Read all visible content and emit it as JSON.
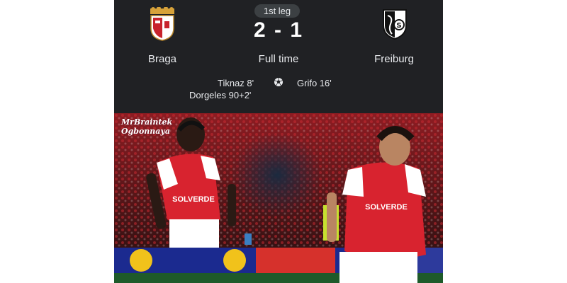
{
  "match": {
    "leg_label": "1st leg",
    "score": "2 - 1",
    "status": "Full time",
    "home": {
      "name": "Braga",
      "crest_icon": "braga-crest-icon",
      "scorers": [
        "Tiknaz 8'",
        "Dorgeles 90+2'"
      ]
    },
    "away": {
      "name": "Freiburg",
      "crest_icon": "freiburg-crest-icon",
      "scorers": [
        "Grifo 16'"
      ]
    },
    "goal_icon": "soccer-ball-icon"
  },
  "photo": {
    "watermark_lines": [
      "MrBraintek",
      "Ogbonnaya"
    ],
    "shirt_sponsor": "SOLVERDE",
    "kit_colors": {
      "shirt": "#d8232f",
      "sleeves": "#ffffff",
      "shorts": "#ffffff"
    }
  },
  "theme": {
    "panel_bg": "#202124",
    "text": "#e8eaed",
    "badge_bg": "#3c4043"
  }
}
